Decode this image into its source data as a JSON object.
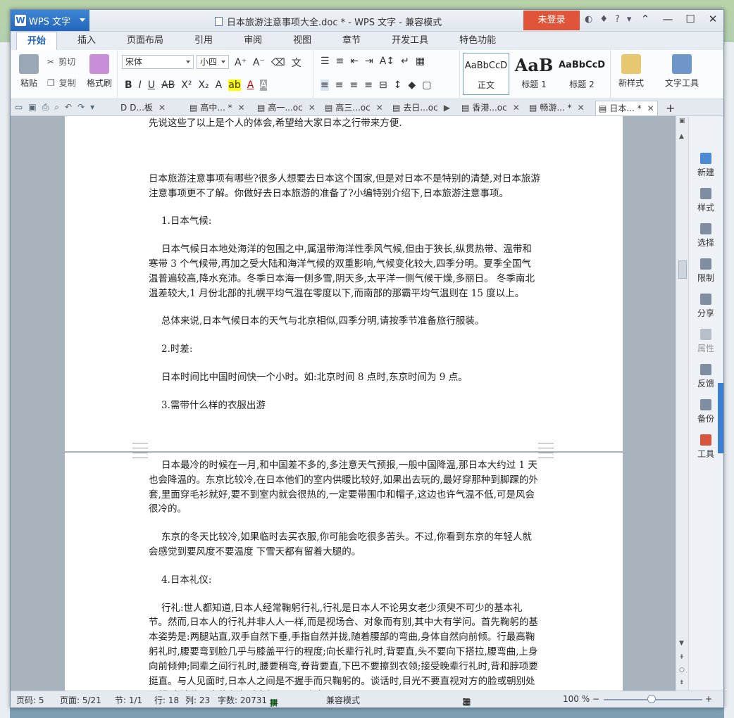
{
  "app": {
    "name": "WPS 文字",
    "window_title": "日本旅游注意事项大全.doc * - WPS 文字 - 兼容模式",
    "login_label": "未登录",
    "help_label": "?"
  },
  "ribbon_tabs": [
    "开始",
    "插入",
    "页面布局",
    "引用",
    "审阅",
    "视图",
    "章节",
    "开发工具",
    "特色功能"
  ],
  "ribbon": {
    "paste": "粘贴",
    "cut": "剪切",
    "copy": "复制",
    "format_painter": "格式刷",
    "font_name": "宋体",
    "font_size": "小四",
    "styles": [
      {
        "preview": "AaBbCcD",
        "label": "正文"
      },
      {
        "preview": "AaB",
        "label": "标题 1"
      },
      {
        "preview": "AaBbCcD",
        "label": "标题 2"
      }
    ],
    "new_style": "新样式",
    "text_tools": "文字工具"
  },
  "doc_tabs": [
    {
      "label": "D...板",
      "active": false
    },
    {
      "label": "高中... *",
      "active": false
    },
    {
      "label": "高一...oc",
      "active": false
    },
    {
      "label": "高三...oc",
      "active": false
    },
    {
      "label": "去日...oc",
      "active": false
    },
    {
      "label": "香港...oc",
      "active": false
    },
    {
      "label": "畅游... *",
      "active": false
    },
    {
      "label": "日本... *",
      "active": true
    }
  ],
  "document": {
    "p0": "先说这些了以上是个人的体会,希望给大家日本之行带来方便.",
    "p1": "日本旅游注意事项有哪些?很多人想要去日本这个国家,但是对日本不是特别的清楚,对日本旅游注意事项更不了解。你做好去日本旅游的准备了?小编特别介绍下,日本旅游注意事项。",
    "p2": "1.日本气候:",
    "p3": "日本气候日本地处海洋的包围之中,属温带海洋性季风气候,但由于狭长,纵贯热带、温带和寒带 3 个气候带,再加之受大陆和海洋气候的双重影响,气候变化较大,四季分明。夏季全国气温普遍较高,降水充沛。冬季日本海一侧多雪,阴天多,太平洋一侧气候干燥,多丽日。 冬季南北温差较大,1 月份北部的扎幌平均气温在零度以下,而南部的那霸平均气温则在 15 度以上。",
    "p4": "总体来说,日本气候日本的天气与北京相似,四季分明,请按季节准备旅行服装。",
    "p5": "2.时差:",
    "p6": "日本时间比中国时间快一个小时。如:北京时间 8 点时,东京时间为 9 点。",
    "p7": "3.需带什么样的衣服出游",
    "p8": "日本最冷的时候在一月,和中国差不多的,多注意天气预报,一般中国降温,那日本大约过 1 天也会降温的。东京比较冷,在日本他们的室内供暖比较好,如果出去玩的,最好穿那种到脚踝的外套,里面穿毛衫就好,要不到室内就会很热的,一定要带围巾和帽子,这边也许气温不低,可是风会很冷的。",
    "p9": "东京的冬天比较冷,如果临时去买衣服,你可能会吃很多苦头。不过,你看到东京的年轻人就会感觉到要风度不要温度 下雪天都有留着大腿的。",
    "p10": "4.日本礼仪:",
    "p11": "行礼:世人都知道,日本人经常鞠躬行礼,行礼是日本人不论男女老少须臾不可少的基本礼节。然而,日本人的行礼并非人人一样,而是视场合、对象而有别,其中大有学问。首先鞠躬的基本姿势是:两腿站直,双手自然下垂,手指自然并拢,随着腰部的弯曲,身体自然向前倾。行最高鞠躬礼时,腰要弯到脸几乎与膝盖平行的程度;向长辈行礼时,背要直,头不要向下搭拉,腰弯曲,上身向前倾伸;同辈之间行礼时,腰要稍弯,脊背要直,下巴不要擦到衣领;接受晚辈行礼时,背和脖项要挺直。与人见面时,日本人之间是不握手而只鞠躬的。谈话时,目光不要直视对方的脸或朝别处观望,应该使目光停留在对方领以下、肚脐"
  },
  "side_panel": [
    "新建",
    "样式",
    "选择",
    "限制",
    "分享",
    "属性",
    "反馈",
    "备份",
    "工具"
  ],
  "status": {
    "page_code": "页码: 5",
    "page": "页面: 5/21",
    "section": "节: 1/1",
    "row": "行: 18",
    "col": "列: 23",
    "words": "字数: 20731",
    "spellcheck": "拼写检查",
    "compat": "兼容模式",
    "zoom": "100 %"
  }
}
